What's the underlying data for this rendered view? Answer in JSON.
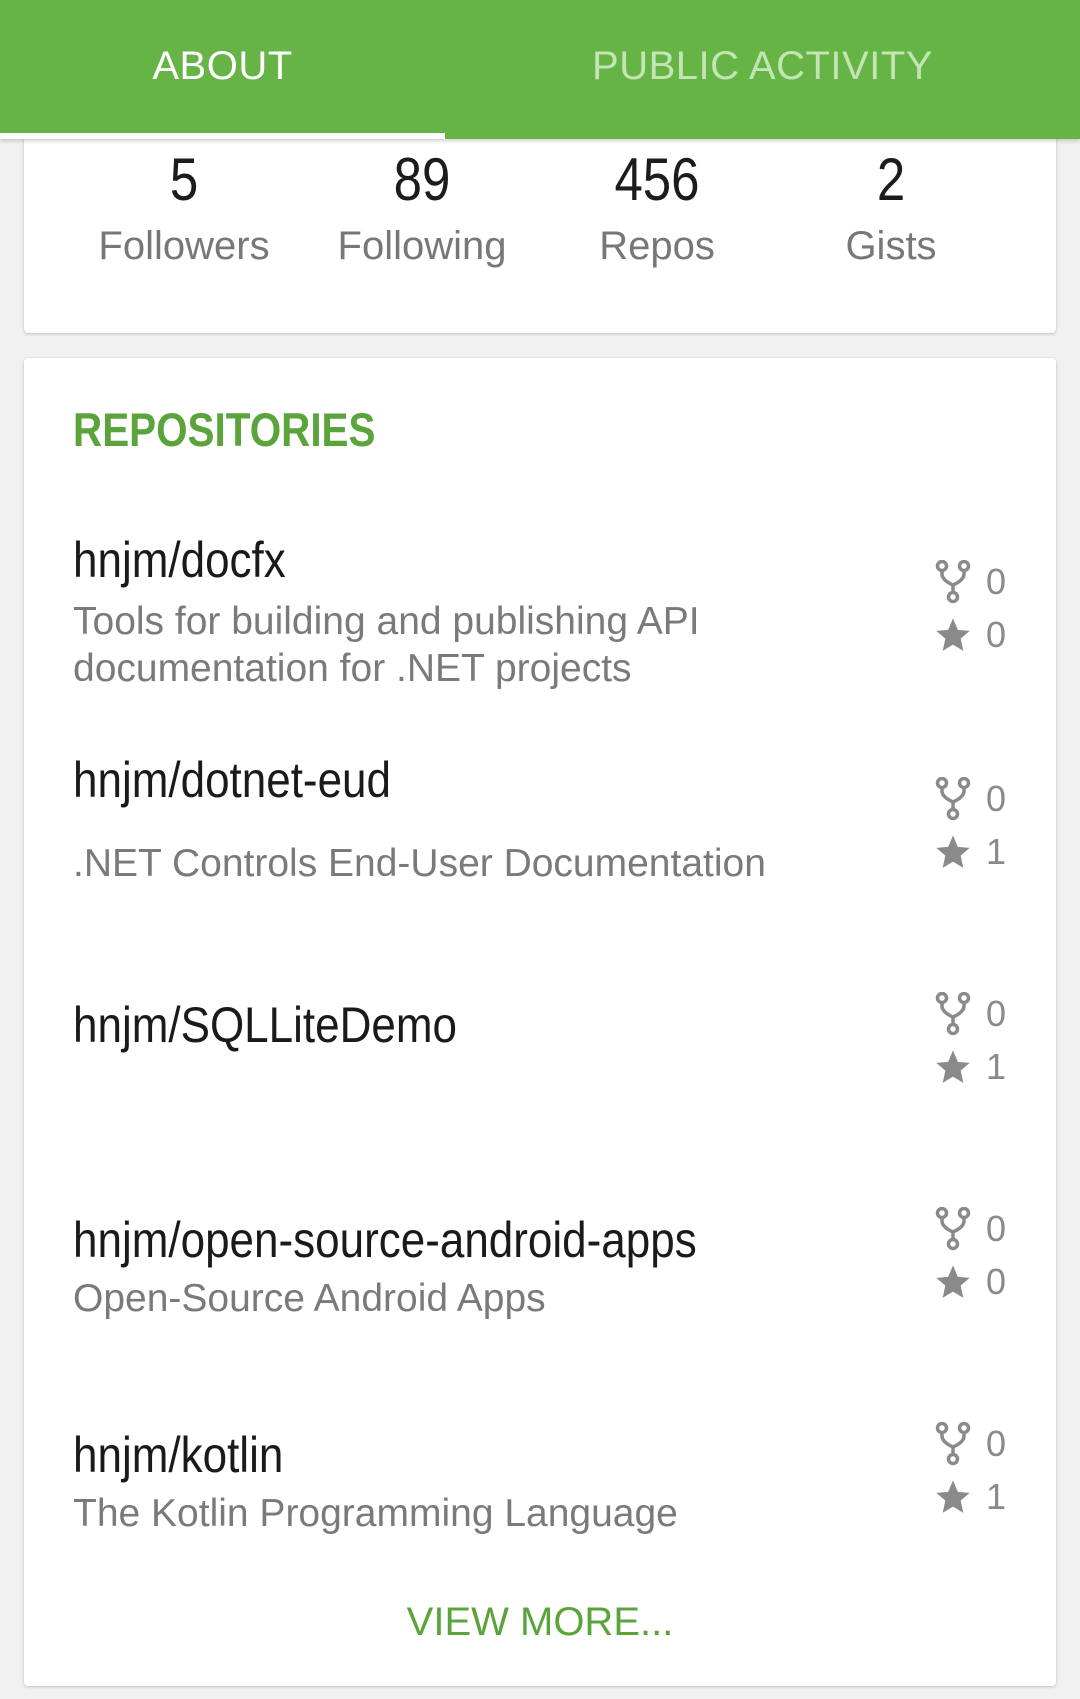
{
  "tabs": {
    "about": "ABOUT",
    "public_activity": "PUBLIC ACTIVITY"
  },
  "stats": {
    "followers": {
      "value": "5",
      "label": "Followers"
    },
    "following": {
      "value": "89",
      "label": "Following"
    },
    "repos": {
      "value": "456",
      "label": "Repos"
    },
    "gists": {
      "value": "2",
      "label": "Gists"
    }
  },
  "repositories": {
    "title": "REPOSITORIES",
    "items": [
      {
        "name": "hnjm/docfx",
        "description": "Tools for building and publishing API documentation for .NET projects",
        "forks": "0",
        "stars": "0"
      },
      {
        "name": "hnjm/dotnet-eud",
        "description": ".NET Controls End-User Documentation",
        "forks": "0",
        "stars": "1"
      },
      {
        "name": "hnjm/SQLLiteDemo",
        "description": "",
        "forks": "0",
        "stars": "1"
      },
      {
        "name": "hnjm/open-source-android-apps",
        "description": "Open-Source Android Apps",
        "forks": "0",
        "stars": "0"
      },
      {
        "name": "hnjm/kotlin",
        "description": "The Kotlin Programming Language",
        "forks": "0",
        "stars": "1"
      }
    ],
    "view_more": "VIEW MORE..."
  },
  "colors": {
    "primary": "#66b446",
    "accent_text": "#5ba43c",
    "tab_inactive": "#c3e5b3"
  },
  "icons": {
    "fork": "fork-icon",
    "star": "star-icon"
  }
}
